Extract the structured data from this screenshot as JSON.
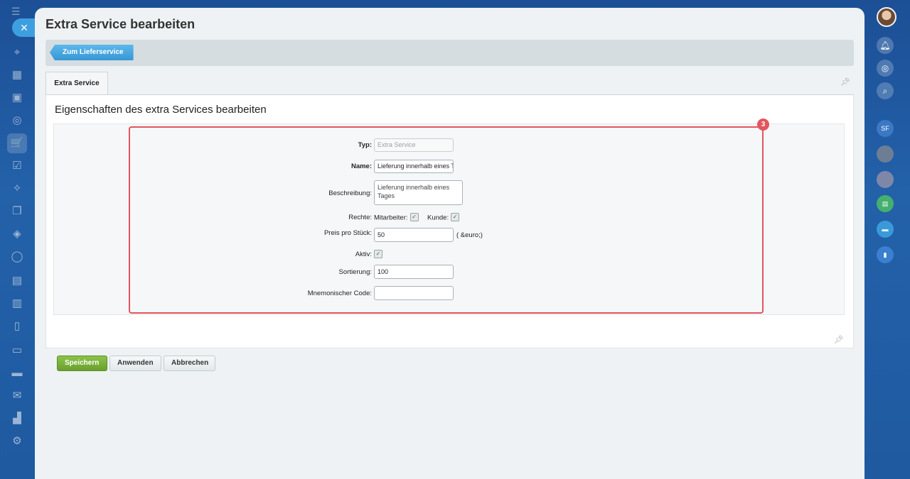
{
  "panel": {
    "title": "Extra Service bearbeiten",
    "back_button": "Zum Lieferservice",
    "tab_label": "Extra Service",
    "section_heading": "Eigenschaften des extra Services bearbeiten",
    "badge": "3"
  },
  "form": {
    "typ_label": "Typ:",
    "typ_value": "Extra Service",
    "name_label": "Name:",
    "name_value": "Lieferung innerhalb eines Tages",
    "beschreibung_label": "Beschreibung:",
    "beschreibung_value": "Lieferung innerhalb eines Tages",
    "rechte_label": "Rechte:",
    "mitarbeiter_label": "Mitarbeiter:",
    "kunde_label": "Kunde:",
    "preis_label": "Preis pro Stück:",
    "preis_value": "50",
    "preis_unit": "( &euro;)",
    "aktiv_label": "Aktiv:",
    "sortierung_label": "Sortierung:",
    "sortierung_value": "100",
    "mnemonic_label": "Mnemonischer Code:",
    "mnemonic_value": ""
  },
  "buttons": {
    "save": "Speichern",
    "apply": "Anwenden",
    "cancel": "Abbrechen"
  },
  "right_rail": {
    "sf_initials": "SF"
  },
  "colors": {
    "accent_blue": "#3d9fe0",
    "highlight_red": "#e2565d",
    "save_green": "#7ab33a"
  }
}
